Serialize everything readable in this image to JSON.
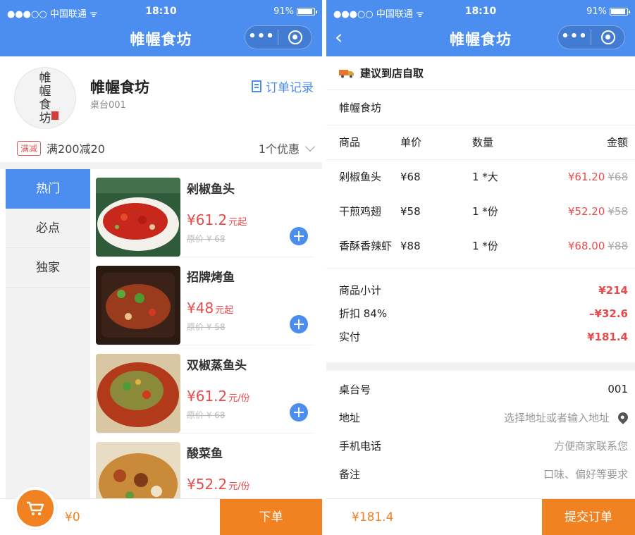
{
  "status": {
    "carrier": "●●●○○ 中国联通 ᯤ",
    "time": "18:10",
    "battery": "91%"
  },
  "nav": {
    "title": "帷幄食坊",
    "back_icon": "chevron-left-icon",
    "more_icon": "more-dots-icon",
    "close_icon": "target-icon"
  },
  "shop": {
    "name": "帷幄食坊",
    "logo_text": "帷幄食坊",
    "table": "桌台001",
    "orders_link": "订单记录",
    "promo_tag": "满减",
    "promo_text": "满200减20",
    "promo_more": "1个优惠"
  },
  "categories": [
    "热门",
    "必点",
    "独家"
  ],
  "dishes": [
    {
      "name": "剁椒鱼头",
      "price": "¥61.2",
      "unit": "元起",
      "orig": "原价 ¥ 68"
    },
    {
      "name": "招牌烤鱼",
      "price": "¥48",
      "unit": "元起",
      "orig": "原价 ¥ 58"
    },
    {
      "name": "双椒蒸鱼头",
      "price": "¥61.2",
      "unit": "元/份",
      "orig": "原价 ¥ 68"
    },
    {
      "name": "酸菜鱼",
      "price": "¥52.2",
      "unit": "元/份",
      "orig": ""
    }
  ],
  "cart": {
    "total": "¥0",
    "order_button": "下单"
  },
  "checkout": {
    "pickup": "建议到店自取",
    "shop_name": "帷幄食坊",
    "headers": [
      "商品",
      "单价",
      "数量",
      "金额"
    ],
    "items": [
      {
        "name": "剁椒鱼头",
        "unit_price": "¥68",
        "qty": "1 *大",
        "amount": "¥61.20",
        "orig": "¥68"
      },
      {
        "name": "干煎鸡翅",
        "unit_price": "¥58",
        "qty": "1 *份",
        "amount": "¥52.20",
        "orig": "¥58"
      },
      {
        "name": "香酥香辣虾",
        "unit_price": "¥88",
        "qty": "1 *份",
        "amount": "¥68.00",
        "orig": "¥88"
      }
    ],
    "subtotal_label": "商品小计",
    "subtotal": "¥214",
    "discount_label": "折扣  84%",
    "discount": "–¥32.6",
    "paid_label": "实付",
    "paid": "¥181.4",
    "table_label": "桌台号",
    "table_value": "001",
    "address_label": "地址",
    "address_placeholder": "选择地址或者输入地址",
    "phone_label": "手机电话",
    "phone_placeholder": "方便商家联系您",
    "note_label": "备注",
    "note_placeholder": "口味、偏好等要求",
    "total": "¥181.4",
    "submit": "提交订单"
  },
  "colors": {
    "primary": "#4b8ef0",
    "accent": "#f08222",
    "price": "#e84b4b"
  }
}
